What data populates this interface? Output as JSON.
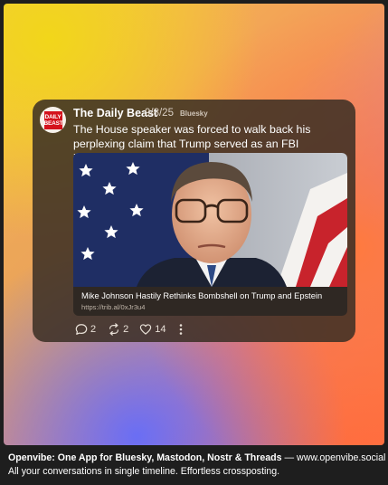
{
  "post": {
    "author": "The Daily Beast",
    "date": "9/8/25",
    "network": "Bluesky",
    "avatar_logo_text": "DAILY BEAST",
    "text": "The House speaker was forced to walk back his perplexing claim that Trump served as an FBI informant on Epstein.",
    "link": {
      "title": "Mike Johnson Hastily Rethinks Bombshell on Trump and Epstein",
      "url": "https://trib.al/0xJr3u4"
    },
    "actions": {
      "replies": "2",
      "reposts": "2",
      "likes": "14"
    }
  },
  "icons": [
    "reply-icon",
    "repost-icon",
    "heart-icon",
    "more-icon"
  ],
  "footer": {
    "title": "Openvibe: One App for Bluesky, Mastodon, Nostr & Threads",
    "separator": " — ",
    "site": "www.openvibe.social",
    "tagline": "All your conversations in single timeline. Effortless crossposting."
  },
  "colors": {
    "card_background": "#3a2e24",
    "logo_red": "#d4121c"
  }
}
